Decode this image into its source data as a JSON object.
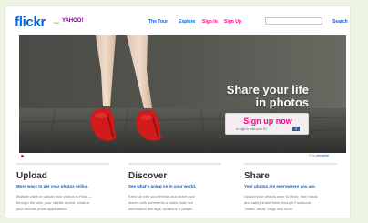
{
  "header": {
    "logo_text": "flickr",
    "logo_from": "from",
    "logo_yahoo": "YAHOO!",
    "nav": [
      {
        "label": "The Tour",
        "accent": false
      },
      {
        "label": "Explore",
        "accent": false
      },
      {
        "label": "Sign In",
        "accent": true
      },
      {
        "label": "Sign Up",
        "accent": true
      }
    ],
    "search_value": "",
    "search_label": "Search"
  },
  "hero": {
    "title_line1": "Share your life",
    "title_line2": "in photos",
    "signup_label": "Sign up now",
    "signup_sub": "or sign in with your ID",
    "credit_prefix": "© by",
    "credit_name": "dimakhin"
  },
  "columns": [
    {
      "title": "Upload",
      "subtitle": "More ways to get your photos online.",
      "body": [
        "Multiple ways to upload your photos to Flickr—",
        "through the web, your mobile device, email or",
        "your favorite photo applications."
      ]
    },
    {
      "title": "Discover",
      "subtitle": "See what's going on in your world.",
      "body": [
        "Keep up with your friends and share your",
        "stories with comments & notes. Add rich",
        "information like tags, locations & people"
      ]
    },
    {
      "title": "Share",
      "subtitle": "Your photos are everywhere you are.",
      "body": [
        "Upload your photos once to Flickr, then easily",
        "and safely share them through Facebook,",
        "Twitter, email, blogs and more."
      ]
    }
  ],
  "colors": {
    "brand_blue": "#0063dc",
    "brand_pink": "#ff0084",
    "shoe_red": "#d11a1a"
  }
}
